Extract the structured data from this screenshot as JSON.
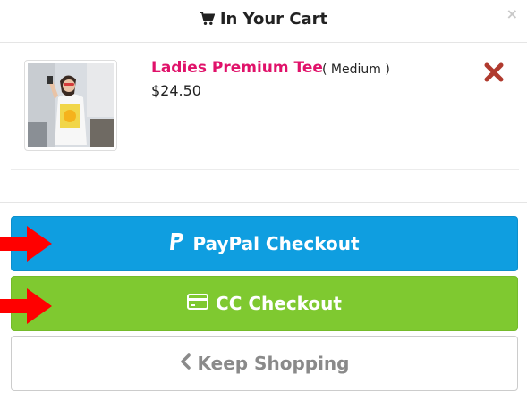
{
  "header": {
    "title": "In Your Cart",
    "close_label": "×"
  },
  "cart": {
    "items": [
      {
        "name": "Ladies Premium Tee",
        "variant": "( Medium )",
        "price": "$24.50"
      }
    ]
  },
  "buttons": {
    "paypal_label": "PayPal Checkout",
    "cc_label": "CC Checkout",
    "keep_shopping_label": "Keep Shopping"
  },
  "colors": {
    "paypal": "#0f9ee0",
    "cc": "#7fc930",
    "product_name": "#e0126a",
    "remove": "#b03a2e",
    "annotation_arrow": "#ff0000"
  },
  "icons": {
    "header": "shopping-cart-icon",
    "close": "close-icon",
    "remove": "remove-item-icon",
    "paypal": "paypal-icon",
    "cc": "credit-card-icon",
    "keep": "chevron-left-icon",
    "annotation": "red-arrow-icon"
  }
}
